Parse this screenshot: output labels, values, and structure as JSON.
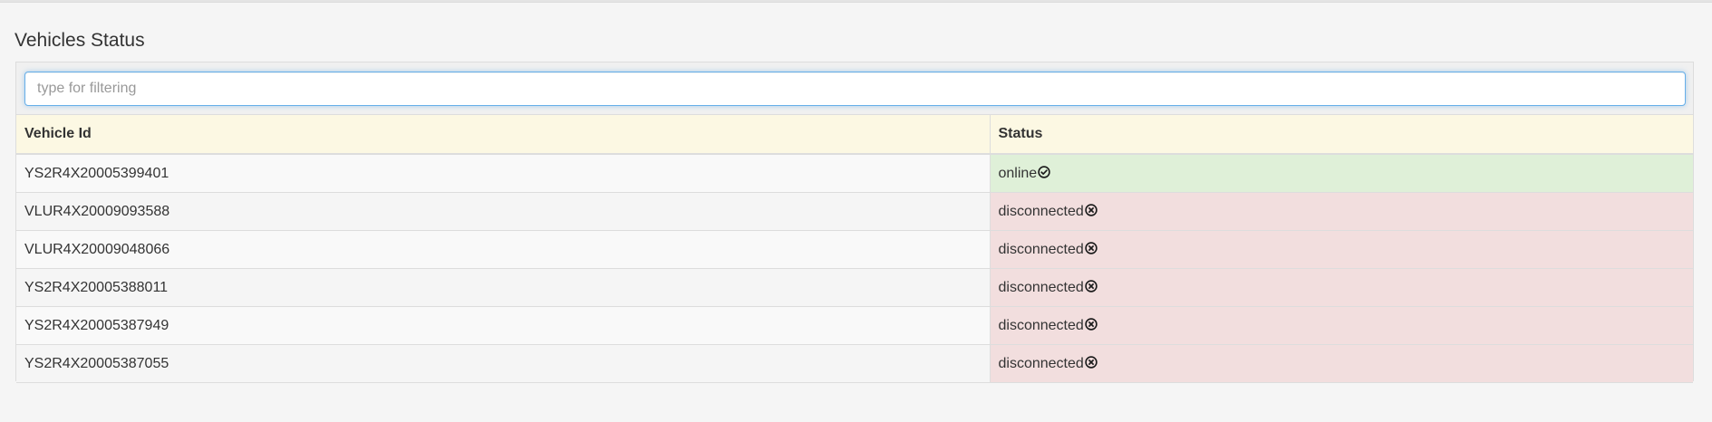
{
  "page": {
    "title": "Vehicles Status"
  },
  "filter": {
    "placeholder": "type for filtering",
    "value": ""
  },
  "table": {
    "columns": [
      "Vehicle Id",
      "Status"
    ],
    "rows": [
      {
        "vehicle_id": "YS2R4X20005399401",
        "status": "online",
        "status_icon": "check-circle-icon"
      },
      {
        "vehicle_id": "VLUR4X20009093588",
        "status": "disconnected",
        "status_icon": "x-circle-icon"
      },
      {
        "vehicle_id": "VLUR4X20009048066",
        "status": "disconnected",
        "status_icon": "x-circle-icon"
      },
      {
        "vehicle_id": "YS2R4X20005388011",
        "status": "disconnected",
        "status_icon": "x-circle-icon"
      },
      {
        "vehicle_id": "YS2R4X20005387949",
        "status": "disconnected",
        "status_icon": "x-circle-icon"
      },
      {
        "vehicle_id": "YS2R4X20005387055",
        "status": "disconnected",
        "status_icon": "x-circle-icon"
      }
    ]
  },
  "colors": {
    "header_bg": "#fcf8e3",
    "online_bg": "#dff0d8",
    "disconnected_bg": "#f2dede",
    "focus_border": "#66afe9"
  }
}
